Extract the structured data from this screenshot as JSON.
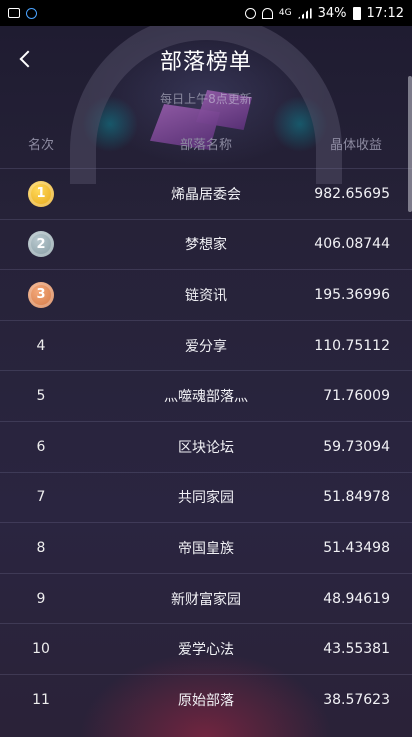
{
  "status_bar": {
    "left_icons": [
      "image-icon",
      "messenger-icon"
    ],
    "right_icons": [
      "alarm-icon",
      "wifi-icon",
      "signal-icon"
    ],
    "network_label": "4G",
    "battery": "34%",
    "time": "17:12"
  },
  "header": {
    "title": "部落榜单",
    "subtitle": "每日上午8点更新",
    "back_icon": "chevron-left-icon"
  },
  "columns": {
    "rank": "名次",
    "name": "部落名称",
    "earnings": "晶体收益"
  },
  "rows": [
    {
      "rank": "1",
      "name": "烯晶居委会",
      "earnings": "982.65695",
      "medal": "gold"
    },
    {
      "rank": "2",
      "name": "梦想家",
      "earnings": "406.08744",
      "medal": "silver"
    },
    {
      "rank": "3",
      "name": "链资讯",
      "earnings": "195.36996",
      "medal": "bronze"
    },
    {
      "rank": "4",
      "name": "爱分享",
      "earnings": "110.75112"
    },
    {
      "rank": "5",
      "name": "灬噬魂部落灬",
      "earnings": "71.76009"
    },
    {
      "rank": "6",
      "name": "区块论坛",
      "earnings": "59.73094"
    },
    {
      "rank": "7",
      "name": "共同家园",
      "earnings": "51.84978"
    },
    {
      "rank": "8",
      "name": "帝国皇族",
      "earnings": "51.43498"
    },
    {
      "rank": "9",
      "name": "新财富家园",
      "earnings": "48.94619"
    },
    {
      "rank": "10",
      "name": "爱学心法",
      "earnings": "43.55381"
    },
    {
      "rank": "11",
      "name": "原始部落",
      "earnings": "38.57623"
    }
  ],
  "colors": {
    "background": "#231f36",
    "gold": "#e4a213",
    "silver": "#7f969d",
    "bronze": "#cf7340"
  }
}
